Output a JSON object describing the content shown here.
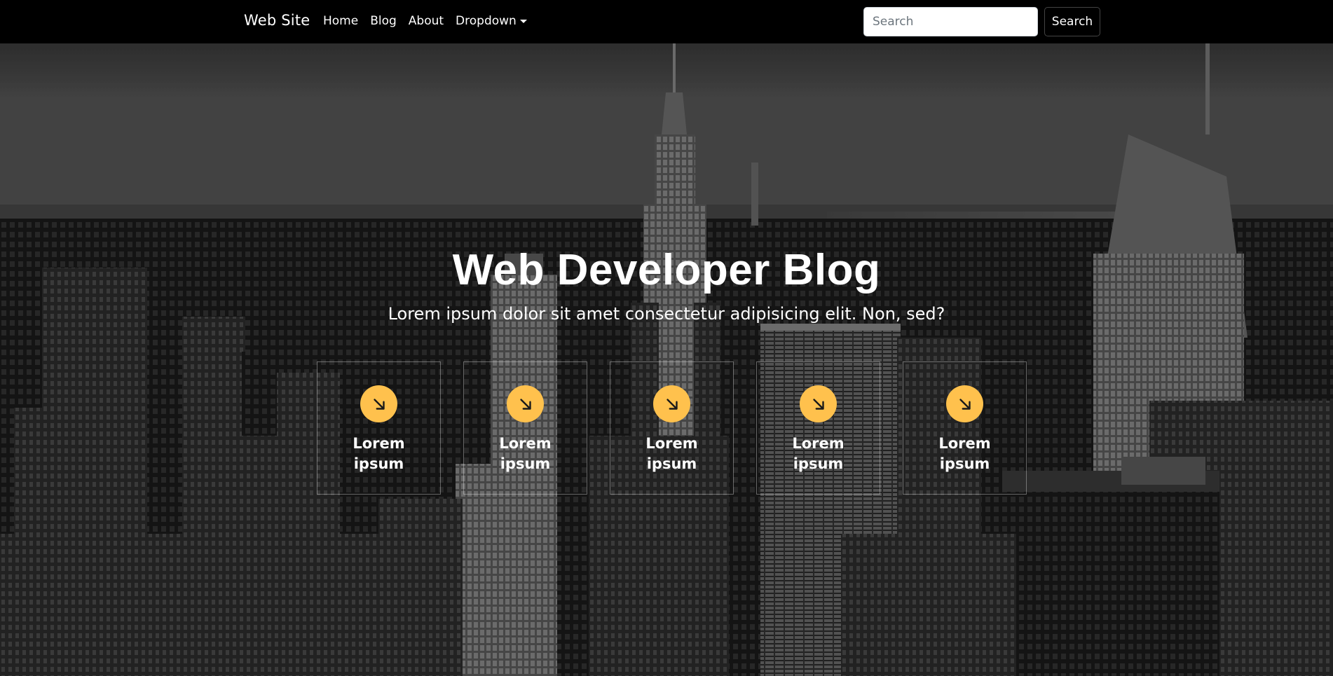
{
  "navbar": {
    "brand": "Web Site",
    "links": [
      {
        "label": "Home"
      },
      {
        "label": "Blog"
      },
      {
        "label": "About"
      },
      {
        "label": "Dropdown"
      }
    ],
    "search_placeholder": "Search",
    "search_button": "Search"
  },
  "hero": {
    "title": "Web Developer Blog",
    "subtitle": "Lorem ipsum dolor sit amet consectetur adipisicing elit. Non, sed?",
    "features": [
      {
        "label": "Lorem ipsum",
        "icon": "arrow-down-right-icon"
      },
      {
        "label": "Lorem ipsum",
        "icon": "arrow-down-right-icon"
      },
      {
        "label": "Lorem ipsum",
        "icon": "arrow-down-right-icon"
      },
      {
        "label": "Lorem ipsum",
        "icon": "arrow-down-right-icon"
      },
      {
        "label": "Lorem ipsum",
        "icon": "arrow-down-right-icon"
      }
    ]
  },
  "colors": {
    "navbar_bg": "#000000",
    "accent": "#ffc14d",
    "text": "#ffffff"
  }
}
